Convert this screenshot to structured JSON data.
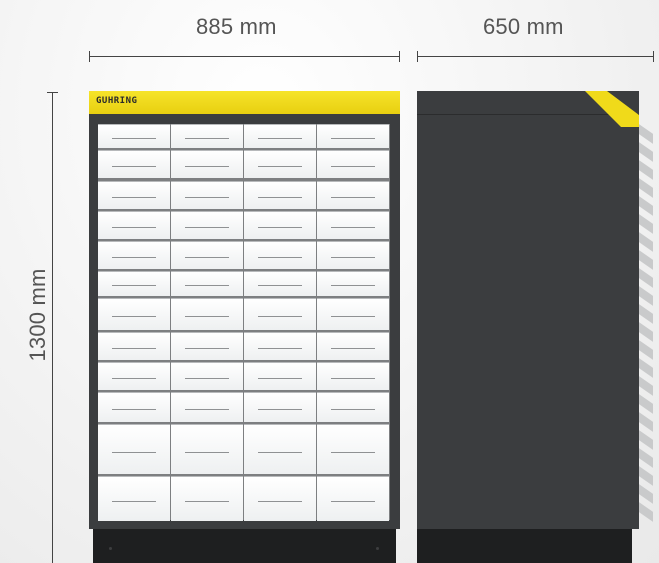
{
  "dimensions": {
    "width_front": "885 mm",
    "width_side": "650 mm",
    "height": "1300 mm"
  },
  "brand": "GUHRING",
  "colors": {
    "cabinet_body": "#3b3d3f",
    "cabinet_top": "#f0da1a",
    "drawer_front": "#f4f5f6",
    "base": "#1e1f20"
  },
  "drawers": {
    "columns": 4,
    "rows": 12
  }
}
